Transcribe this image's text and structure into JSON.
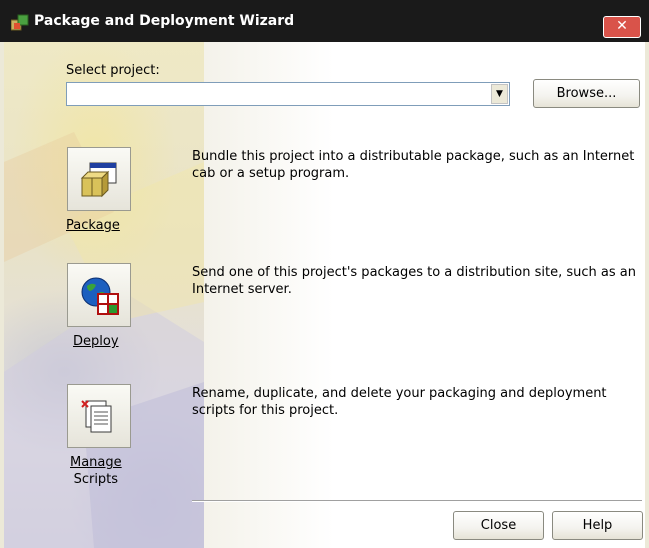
{
  "window": {
    "title": "Package and Deployment Wizard",
    "close_icon": "close-icon",
    "title_icon": "package-wizard-icon"
  },
  "project": {
    "label": "Select project:",
    "value": "",
    "dropdown_icon": "chevron-down-icon",
    "browse_label": "Browse..."
  },
  "options": [
    {
      "label": "Package",
      "icon": "package-icon",
      "description": "Bundle this project into a distributable package, such as an Internet cab or a setup program."
    },
    {
      "label": "Deploy",
      "icon": "deploy-globe-icon",
      "description": "Send one of this project's packages to a distribution site, such as an Internet server."
    },
    {
      "label": "Manage Scripts",
      "label_line1": "Manage",
      "label_line2": "Scripts",
      "icon": "scripts-icon",
      "description": "Rename, duplicate, and delete your packaging and deployment scripts for this project."
    }
  ],
  "footer": {
    "close_label": "Close",
    "help_label": "Help"
  },
  "colors": {
    "titlebar": "#1a1a1a",
    "close_button": "#d9534a",
    "dialog_face": "#ece9d8"
  }
}
